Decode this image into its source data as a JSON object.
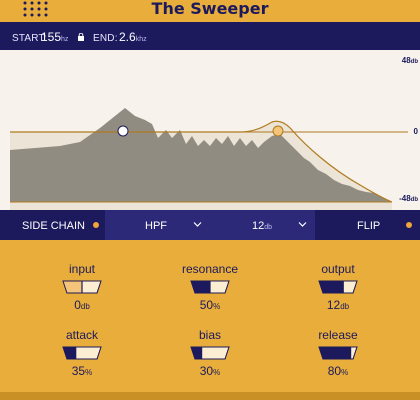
{
  "header": {
    "title": "The Sweeper",
    "logo": "dot-grid-logo"
  },
  "range": {
    "start_label": "START:",
    "start_value": "155",
    "start_unit": "hz",
    "end_label": "END:",
    "end_value": "2.6",
    "end_unit": "khz",
    "lock_icon": "lock-icon"
  },
  "graph": {
    "top_db": "48",
    "zero_db": "0",
    "bottom_db": "-48",
    "db_unit": "db"
  },
  "controls": {
    "sidechain": "SIDE CHAIN",
    "filter": "HPF",
    "slope_value": "12",
    "slope_unit": "db",
    "flip": "FLIP"
  },
  "knobs": [
    {
      "name": "input",
      "value": "0",
      "unit": "db",
      "level": 0.5
    },
    {
      "name": "resonance",
      "value": "50",
      "unit": "%",
      "level": 0.5
    },
    {
      "name": "output",
      "value": "12",
      "unit": "db",
      "level": 0.625
    },
    {
      "name": "attack",
      "value": "35",
      "unit": "%",
      "level": 0.35
    },
    {
      "name": "bias",
      "value": "30",
      "unit": "%",
      "level": 0.3
    },
    {
      "name": "release",
      "value": "80",
      "unit": "%",
      "level": 0.8
    }
  ],
  "colors": {
    "navy": "#1c1a5c",
    "amber": "#e8ad3a",
    "accent": "#f0a43a"
  }
}
